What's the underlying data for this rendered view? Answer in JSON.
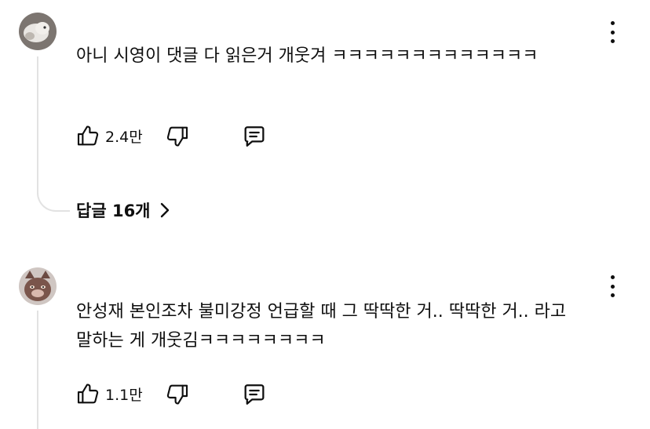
{
  "comments": [
    {
      "text": "아니 시영이 댓글 다 읽은거 개웃겨 ㅋㅋㅋㅋㅋㅋㅋㅋㅋㅋㅋㅋㅋ",
      "likes": "2.4만",
      "replies_label": "답글 16개"
    },
    {
      "text": "안성재 본인조차 불미강정 언급할 때 그 딱딱한 거.. 딱딱한 거.. 라고 말하는 게 개웃김ㅋㅋㅋㅋㅋㅋㅋㅋ",
      "likes": "1.1만"
    }
  ],
  "icons": {
    "like": "thumbs-up-icon",
    "dislike": "thumbs-down-icon",
    "reply": "reply-icon",
    "more": "more-vert-icon",
    "chevron": "chevron-right-icon"
  }
}
